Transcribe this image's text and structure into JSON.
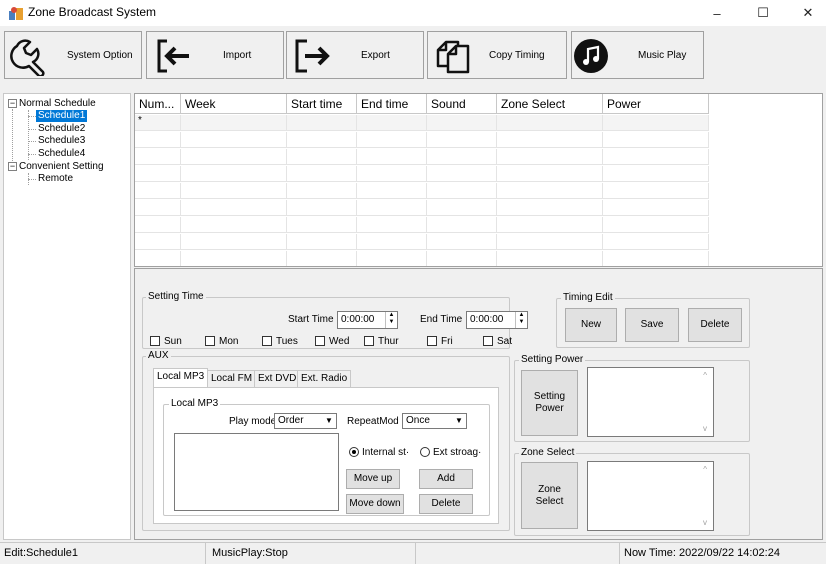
{
  "window": {
    "title": "Zone Broadcast System",
    "minimize": "–",
    "maximize": "☐",
    "close": "✕"
  },
  "toolbar": {
    "system_option": "System Option",
    "import": "Import",
    "export": "Export",
    "copy_timing": "Copy Timing",
    "music_play": "Music Play"
  },
  "tree": {
    "normal_schedule": "Normal Schedule",
    "items": [
      "Schedule1",
      "Schedule2",
      "Schedule3",
      "Schedule4"
    ],
    "convenient_setting": "Convenient Setting",
    "remote": "Remote",
    "collapse_glyph": "−"
  },
  "grid": {
    "columns": [
      "Num...",
      "Week",
      "Start time",
      "End time",
      "Sound",
      "Zone Select",
      "Power"
    ],
    "new_row_marker": "*"
  },
  "setting_time": {
    "group_label": "Setting Time",
    "start_time_label": "Start Time",
    "start_time_value": "0:00:00",
    "end_time_label": "End Time",
    "end_time_value": "0:00:00",
    "days": [
      "Sun",
      "Mon",
      "Tues",
      "Wed",
      "Thur",
      "Fri",
      "Sat"
    ]
  },
  "timing_edit": {
    "group_label": "Timing Edit",
    "new": "New",
    "save": "Save",
    "delete": "Delete"
  },
  "aux": {
    "group_label": "AUX",
    "tabs": [
      "Local MP3",
      "Local FM",
      "Ext DVD",
      "Ext. Radio"
    ],
    "local_mp3_label": "Local MP3",
    "play_mode_label": "Play mode",
    "play_mode_value": "Order",
    "repeat_mode_label": "RepeatMod",
    "repeat_mode_value": "Once",
    "internal_storage": "Internal st·",
    "ext_storage": "Ext stroag·",
    "move_up": "Move up",
    "add": "Add",
    "move_down": "Move down",
    "delete": "Delete"
  },
  "setting_power": {
    "group_label": "Setting Power",
    "button": "Setting Power"
  },
  "zone_select": {
    "group_label": "Zone Select",
    "button": "Zone Select"
  },
  "status": {
    "edit": "Edit:Schedule1",
    "music_play": "MusicPlay:Stop",
    "now_time": "Now Time:  2022/09/22 14:02:24"
  }
}
